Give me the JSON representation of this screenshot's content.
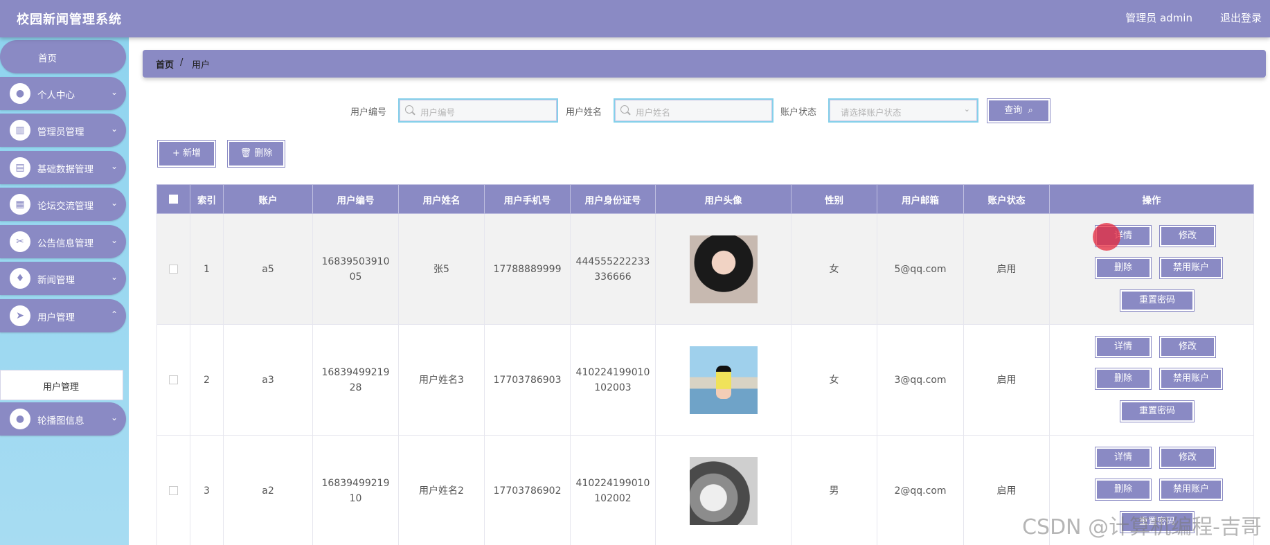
{
  "header": {
    "title": "校园新闻管理系统",
    "user": "管理员 admin",
    "logout": "退出登录"
  },
  "sidebar": {
    "home": "首页",
    "items": [
      {
        "label": "个人中心",
        "icon": "user-icon"
      },
      {
        "label": "管理员管理",
        "icon": "book-icon"
      },
      {
        "label": "基础数据管理",
        "icon": "clipboard-icon"
      },
      {
        "label": "论坛交流管理",
        "icon": "grid-icon"
      },
      {
        "label": "公告信息管理",
        "icon": "ticket-icon"
      },
      {
        "label": "新闻管理",
        "icon": "bulb-icon"
      },
      {
        "label": "用户管理",
        "icon": "send-icon"
      },
      {
        "label": "轮播图信息",
        "icon": "user-icon"
      }
    ],
    "sub_item": "用户管理"
  },
  "breadcrumb": {
    "home": "首页",
    "sep": "/",
    "current": "用户"
  },
  "search": {
    "fields": [
      {
        "label": "用户编号",
        "placeholder": "用户编号"
      },
      {
        "label": "用户姓名",
        "placeholder": "用户姓名"
      },
      {
        "label": "账户状态",
        "placeholder": "请选择账户状态"
      }
    ],
    "query": "查询"
  },
  "actions": {
    "add": "+ 新增",
    "delete": "删除"
  },
  "table": {
    "headers": [
      "",
      "索引",
      "账户",
      "用户编号",
      "用户姓名",
      "用户手机号",
      "用户身份证号",
      "用户头像",
      "性别",
      "用户邮箱",
      "账户状态",
      "操作"
    ],
    "rows": [
      {
        "index": "1",
        "account": "a5",
        "number": "16839503910 05",
        "name": "张5",
        "phone": "17788889999",
        "idcard": "444555222233 336666",
        "gender": "女",
        "email": "5@qq.com",
        "status": "启用"
      },
      {
        "index": "2",
        "account": "a3",
        "number": "16839499219 28",
        "name": "用户姓名3",
        "phone": "17703786903",
        "idcard": "410224199010 102003",
        "gender": "女",
        "email": "3@qq.com",
        "status": "启用"
      },
      {
        "index": "3",
        "account": "a2",
        "number": "16839499219 10",
        "name": "用户姓名2",
        "phone": "17703786902",
        "idcard": "410224199010 102002",
        "gender": "男",
        "email": "2@qq.com",
        "status": "启用"
      }
    ],
    "ops": {
      "detail": "详情",
      "edit": "修改",
      "delete": "删除",
      "disable": "禁用账户",
      "reset": "重置密码"
    }
  },
  "watermark": "CSDN @计算机编程-吉哥",
  "colors": {
    "primary": "#8a8ac4",
    "sidebar": "#9fd9f0",
    "input_border": "#85d0ea"
  }
}
